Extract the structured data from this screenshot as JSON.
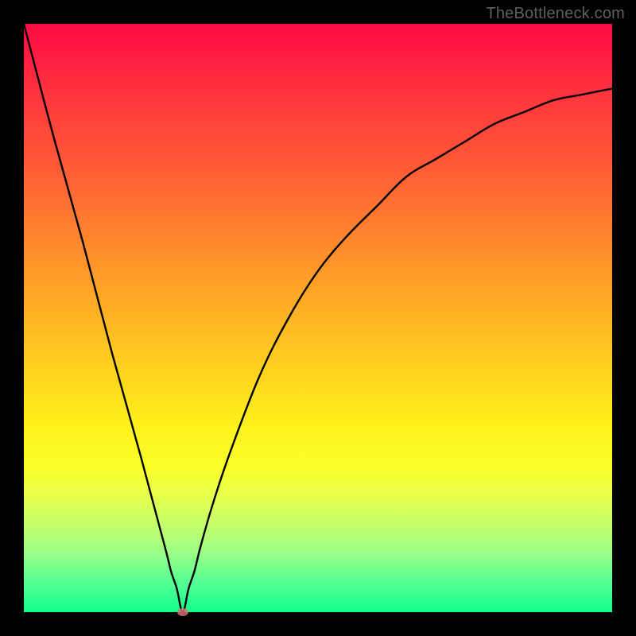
{
  "watermark": {
    "text": "TheBottleneck.com"
  },
  "colors": {
    "frame_bg_top": "#ff0a45",
    "frame_bg_bottom": "#12ff8a",
    "border": "#000000",
    "curve": "#000000",
    "marker": "#d6726f"
  },
  "chart_data": {
    "type": "line",
    "title": "",
    "xlabel": "",
    "ylabel": "",
    "xlim": [
      0,
      100
    ],
    "ylim": [
      0,
      100
    ],
    "grid": false,
    "legend": false,
    "marker": {
      "x": 27,
      "y": 0
    },
    "series": [
      {
        "name": "bottleneck-curve",
        "x": [
          0,
          5,
          10,
          15,
          20,
          24,
          25,
          26,
          27,
          28,
          29,
          30,
          32,
          35,
          40,
          45,
          50,
          55,
          60,
          65,
          70,
          75,
          80,
          85,
          90,
          95,
          100
        ],
        "y": [
          100,
          81,
          63,
          44,
          26,
          11,
          7,
          4,
          0,
          4,
          7,
          11,
          18,
          27,
          40,
          50,
          58,
          64,
          69,
          74,
          77,
          80,
          83,
          85,
          87,
          88,
          89
        ]
      }
    ]
  }
}
